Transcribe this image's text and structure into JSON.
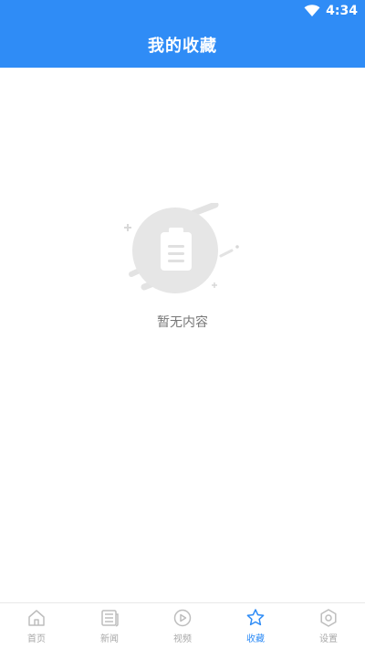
{
  "status_bar": {
    "time": "4:34"
  },
  "header": {
    "title": "我的收藏"
  },
  "empty_state": {
    "text": "暂无内容"
  },
  "bottom_nav": {
    "items": [
      {
        "label": "首页",
        "icon": "home-icon",
        "active": false
      },
      {
        "label": "新闻",
        "icon": "news-icon",
        "active": false
      },
      {
        "label": "视频",
        "icon": "video-icon",
        "active": false
      },
      {
        "label": "收藏",
        "icon": "star-icon",
        "active": true
      },
      {
        "label": "设置",
        "icon": "settings-icon",
        "active": false
      }
    ]
  },
  "colors": {
    "primary": "#2f8cf6",
    "inactive": "#a8a8a8",
    "placeholder": "#e6e6e6"
  }
}
